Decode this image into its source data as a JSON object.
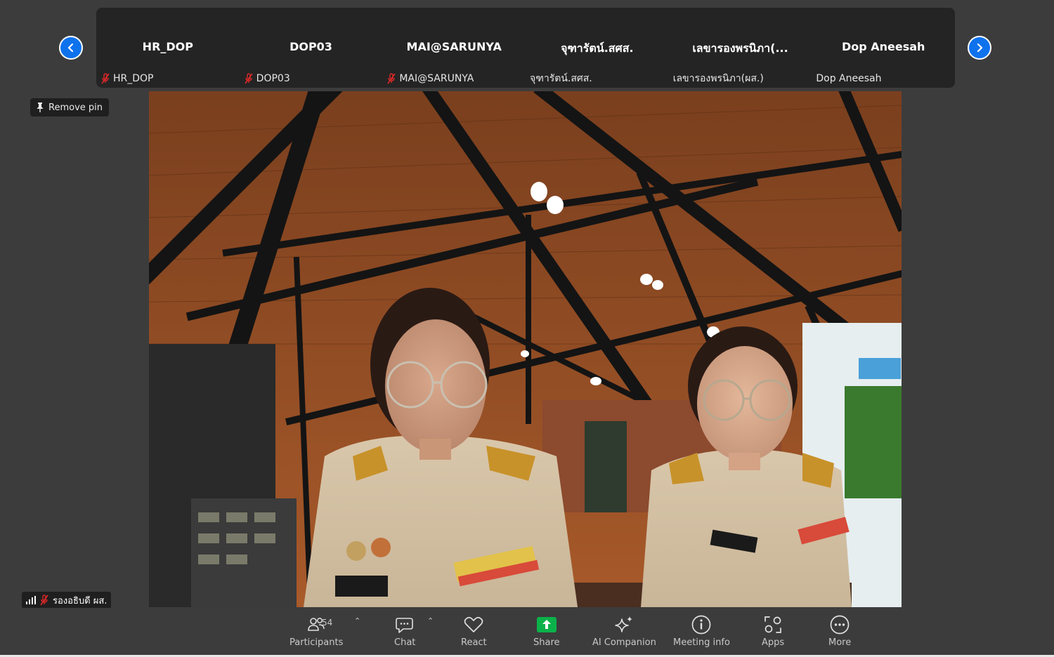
{
  "gallery": {
    "tiles": [
      {
        "display_name": "HR_DOP",
        "label": "HR_DOP",
        "muted": true
      },
      {
        "display_name": "DOP03",
        "label": "DOP03",
        "muted": true
      },
      {
        "display_name": "MAI@SARUNYA",
        "label": "MAI@SARUNYA",
        "muted": true
      },
      {
        "display_name": "จุฑารัตน์.สศส.",
        "label": "จุฑารัตน์.สศส.",
        "muted": false
      },
      {
        "display_name": "เลขารองพรนิภา(...",
        "label": "เลขารองพรนิภา(ผส.)",
        "muted": false
      },
      {
        "display_name": "Dop Aneesah",
        "label": "Dop Aneesah",
        "muted": false
      }
    ]
  },
  "pin": {
    "label": "Remove pin"
  },
  "speaker": {
    "label": "รองอธิบดี ผส."
  },
  "toolbar": {
    "participants_label": "Participants",
    "participants_count": "54",
    "chat_label": "Chat",
    "react_label": "React",
    "share_label": "Share",
    "ai_label": "AI Companion",
    "info_label": "Meeting info",
    "apps_label": "Apps",
    "more_label": "More"
  },
  "colors": {
    "accent_blue": "#0e72ed",
    "share_green": "#0bb24a",
    "muted_red": "#e02828"
  }
}
